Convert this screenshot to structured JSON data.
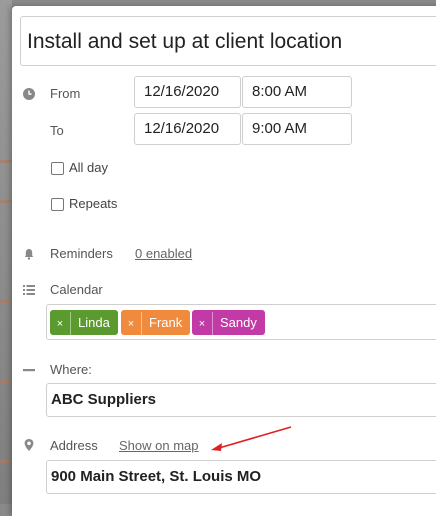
{
  "event": {
    "title": "Install and set up at client location"
  },
  "schedule": {
    "from_label": "From",
    "to_label": "To",
    "from_date": "12/16/2020",
    "from_time": "8:00 AM",
    "to_date": "12/16/2020",
    "to_time": "9:00 AM",
    "all_day_label": "All day",
    "all_day_checked": false,
    "repeats_label": "Repeats",
    "repeats_checked": false
  },
  "reminders": {
    "label": "Reminders",
    "link": "0 enabled"
  },
  "calendar": {
    "label": "Calendar",
    "tags": [
      {
        "name": "Linda",
        "color": "#5a9a2e"
      },
      {
        "name": "Frank",
        "color": "#f08a3c"
      },
      {
        "name": "Sandy",
        "color": "#c23aa6"
      }
    ],
    "remove_glyph": "×"
  },
  "where": {
    "label": "Where:",
    "value": "ABC Suppliers"
  },
  "address": {
    "label": "Address",
    "map_link": "Show on map",
    "value": "900 Main Street, St. Louis MO"
  },
  "icons": {
    "from": "clock-icon",
    "reminders": "bell-icon",
    "calendar": "list-icon",
    "where": "dash-icon",
    "address": "map-pin-icon"
  },
  "colors": {
    "annotation_arrow": "#e02020"
  }
}
